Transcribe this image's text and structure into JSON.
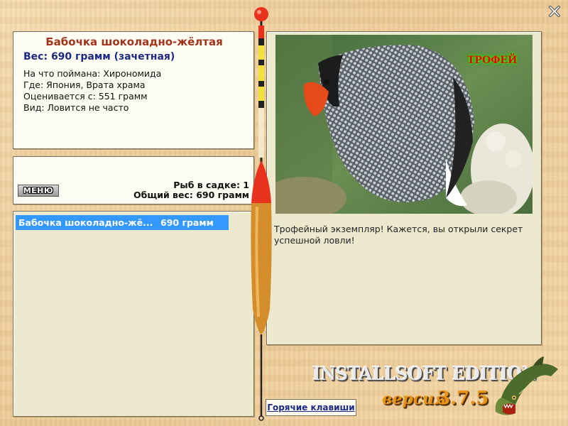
{
  "fish": {
    "name": "Бабочка шоколадно-жёлтая",
    "weight": "Вес: 690 грамм (зачетная)",
    "bait": "На что поймана: Хирономида",
    "location": "Где: Япония, Врата храма",
    "scored_from": "Оценивается с: 551 грамм",
    "rarity": "Вид: Ловится не часто"
  },
  "stats": {
    "menu_label": "МЕНЮ",
    "fish_in_keepnet": "Рыб в садке: 1",
    "total_weight": "Общий вес: 690 грамм"
  },
  "catch_list": [
    {
      "name": "Бабочка шоколадно-жё...",
      "weight": "690 грамм"
    }
  ],
  "photo": {
    "trophy_badge": "ТРОФЕЙ",
    "message": "Трофейный экземпляр! Кажется, вы открыли секрет успешной ловли!"
  },
  "hotkeys_label": "Горячие клавиши",
  "branding": {
    "edition": "INSTALLSOFT EDITION",
    "version_label": "версия",
    "version_number": "3.7.5"
  },
  "icons": {
    "close": "close-icon",
    "float": "fishing-float-icon",
    "logo": "pike-fish-logo"
  },
  "colors": {
    "fish_name": "#a3331b",
    "weight": "#1c2a86",
    "selection": "#3399ff",
    "version": "#e89418"
  }
}
